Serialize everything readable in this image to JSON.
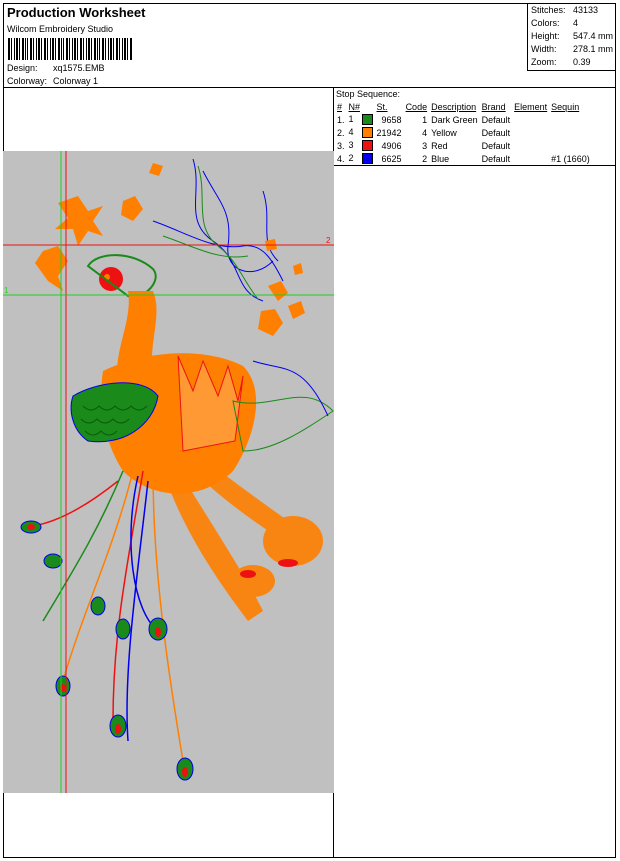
{
  "header": {
    "title": "Production Worksheet",
    "software": "Wilcom Embroidery Studio",
    "design_label": "Design:",
    "design_value": "xq1575.EMB",
    "colorway_label": "Colorway:",
    "colorway_value": "Colorway 1"
  },
  "stats": [
    {
      "label": "Stitches:",
      "value": "43133"
    },
    {
      "label": "Colors:",
      "value": "4"
    },
    {
      "label": "Height:",
      "value": "547.4 mm"
    },
    {
      "label": "Width:",
      "value": "278.1 mm"
    },
    {
      "label": "Zoom:",
      "value": "0.39"
    }
  ],
  "stop_sequence": {
    "caption": "Stop Sequence:",
    "columns": [
      "#",
      "N#",
      "St.",
      "Code",
      "Description",
      "Brand",
      "Element",
      "Sequin"
    ],
    "rows": [
      {
        "num": "1.",
        "n": "1",
        "color": "#1a8a1a",
        "st": "9658",
        "code": "1",
        "desc": "Dark Green",
        "brand": "Default",
        "element": "",
        "sequin": ""
      },
      {
        "num": "2.",
        "n": "4",
        "color": "#ff7f00",
        "st": "21942",
        "code": "4",
        "desc": "Yellow",
        "brand": "Default",
        "element": "",
        "sequin": ""
      },
      {
        "num": "3.",
        "n": "3",
        "color": "#ee1111",
        "st": "4906",
        "code": "3",
        "desc": "Red",
        "brand": "Default",
        "element": "",
        "sequin": ""
      },
      {
        "num": "4.",
        "n": "2",
        "color": "#0000ee",
        "st": "6625",
        "code": "2",
        "desc": "Blue",
        "brand": "Default",
        "element": "",
        "sequin": "#1 (1660)"
      }
    ]
  },
  "markers": {
    "red_label": "2",
    "green_label": "1"
  },
  "colors": {
    "background": "#c0c0c0",
    "orange": "#ff7f00",
    "green": "#1a8a1a",
    "red": "#ee1111",
    "blue": "#0000ee"
  }
}
